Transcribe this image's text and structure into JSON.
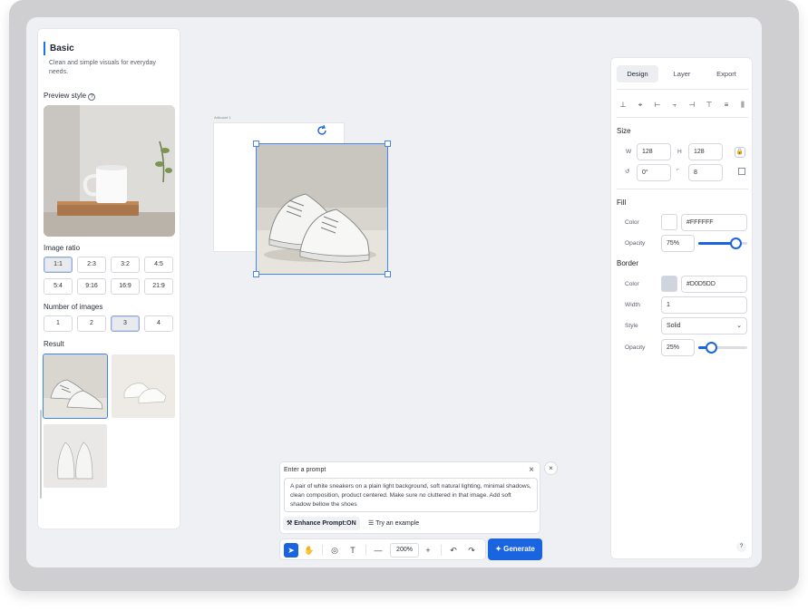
{
  "left_panel": {
    "title": "Basic",
    "description": "Clean and simple visuals for everyday needs.",
    "preview_style_label": "Preview style",
    "image_ratio_label": "Image ratio",
    "ratios": [
      "1:1",
      "2:3",
      "3:2",
      "4:5",
      "5:4",
      "9:16",
      "16:9",
      "21:9"
    ],
    "selected_ratio": "1:1",
    "number_of_images_label": "Number of images",
    "counts": [
      "1",
      "2",
      "3",
      "4"
    ],
    "selected_count": "3",
    "result_label": "Result"
  },
  "canvas": {
    "artboard_label": "Artboard 1"
  },
  "prompt": {
    "header": "Enter a prompt",
    "text": "A pair of white sneakers on a plain light background, soft natural lighting, minimal shadows, clean composition, product centered. Make sure no cluttered in that image. Add soft shadow bellow the shoes",
    "enhance_label": "Enhance Prompt:ON",
    "example_label": "Try an example"
  },
  "toolbar": {
    "zoom": "200%",
    "generate_label": "Generate"
  },
  "right_panel": {
    "tabs": [
      "Design",
      "Layer",
      "Export"
    ],
    "active_tab": "Design",
    "size_label": "Size",
    "w_label": "W",
    "w_value": "128",
    "h_label": "H",
    "h_value": "128",
    "rotation_value": "0°",
    "radius_value": "8",
    "fill_label": "Fill",
    "fill_color_label": "Color",
    "fill_color": "#FFFFFF",
    "fill_opacity_label": "Opacity",
    "fill_opacity": "75%",
    "fill_opacity_fraction": 0.75,
    "border_label": "Border",
    "border_color_label": "Color",
    "border_color": "#D0D5DD",
    "width_label": "Width",
    "width_value": "1",
    "style_label": "Style",
    "style_value": "Solid",
    "border_opacity_label": "Opacity",
    "border_opacity": "25%",
    "border_opacity_fraction": 0.25
  },
  "help": "?"
}
